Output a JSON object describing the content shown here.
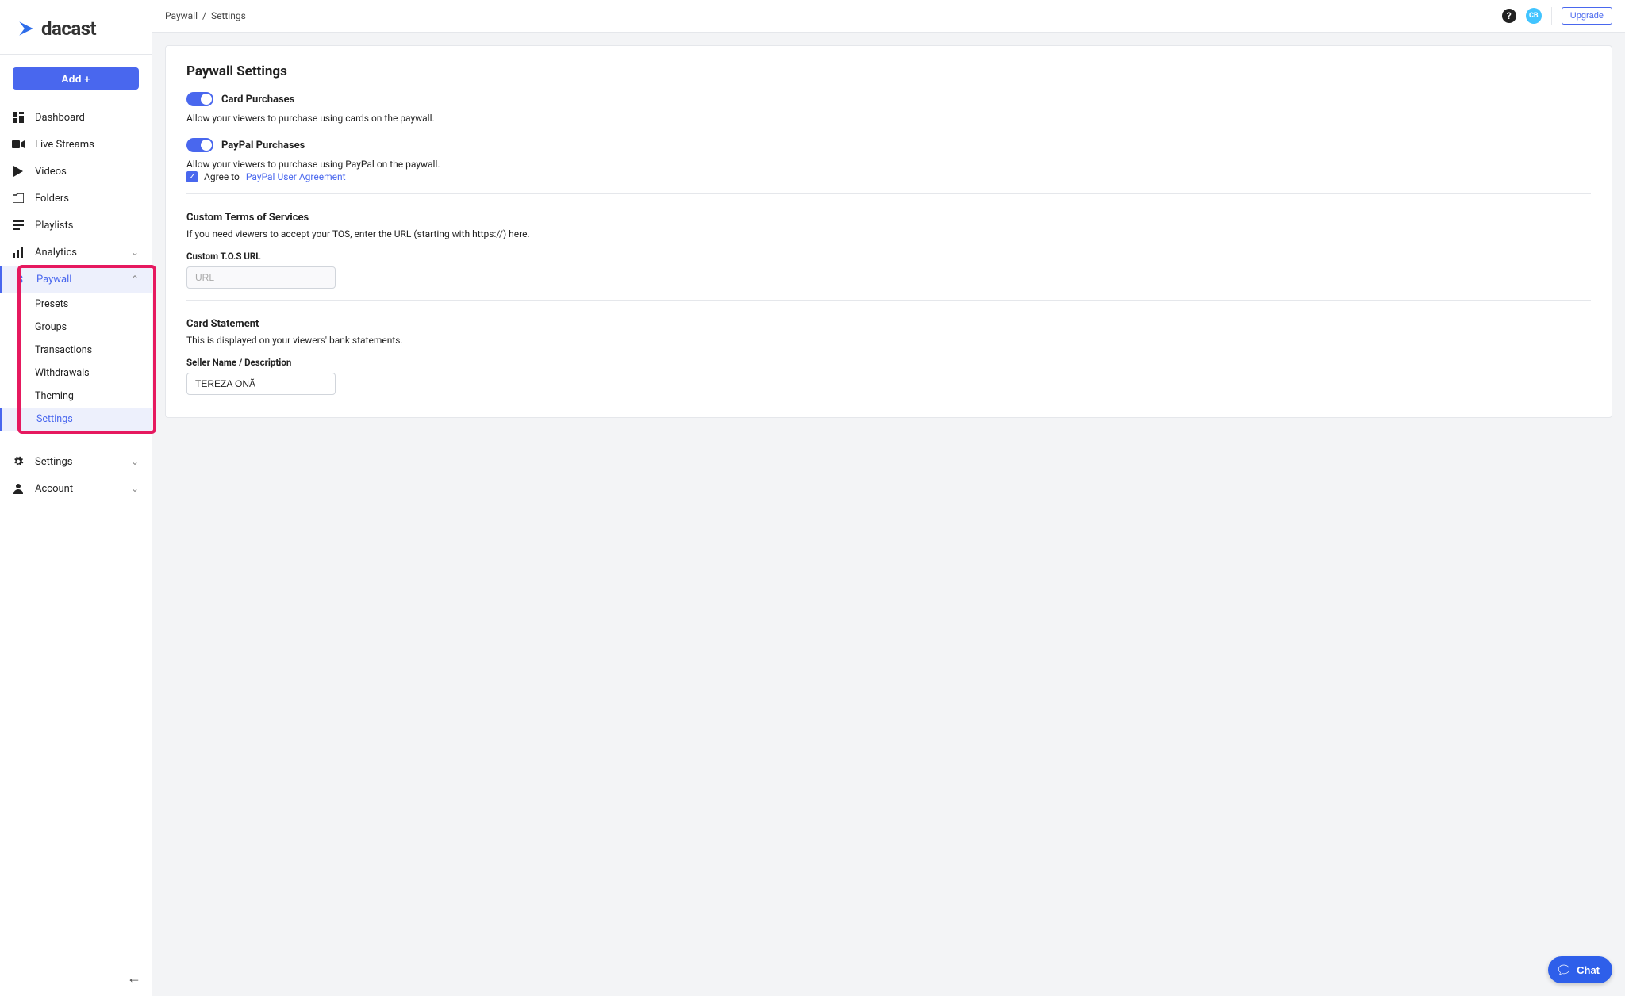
{
  "brand": {
    "name": "dacast"
  },
  "sidebar": {
    "add_label": "Add +",
    "items": {
      "dashboard": "Dashboard",
      "live": "Live Streams",
      "videos": "Videos",
      "folders": "Folders",
      "playlists": "Playlists",
      "analytics": "Analytics",
      "paywall": "Paywall",
      "settings": "Settings",
      "account": "Account"
    },
    "paywall_sub": {
      "presets": "Presets",
      "groups": "Groups",
      "transactions": "Transactions",
      "withdrawals": "Withdrawals",
      "theming": "Theming",
      "settings": "Settings"
    }
  },
  "breadcrumb": {
    "a": "Paywall",
    "sep": "/",
    "b": "Settings"
  },
  "topbar": {
    "avatar": "CB",
    "upgrade": "Upgrade"
  },
  "page": {
    "title": "Paywall Settings",
    "card_purchases": {
      "label": "Card Purchases",
      "desc": "Allow your viewers to purchase using cards on the paywall."
    },
    "paypal_purchases": {
      "label": "PayPal Purchases",
      "desc": "Allow your viewers to purchase using PayPal on the paywall.",
      "agree_prefix": "Agree to ",
      "agree_link": "PayPal User Agreement"
    },
    "tos": {
      "title": "Custom Terms of Services",
      "desc": "If you need viewers to accept your TOS, enter the URL (starting with https://) here.",
      "label": "Custom T.O.S URL",
      "placeholder": "URL"
    },
    "statement": {
      "title": "Card Statement",
      "desc": "This is displayed on your viewers' bank statements.",
      "label": "Seller Name / Description",
      "value": "TEREZA ONÃ"
    }
  },
  "chat": {
    "label": "Chat"
  }
}
